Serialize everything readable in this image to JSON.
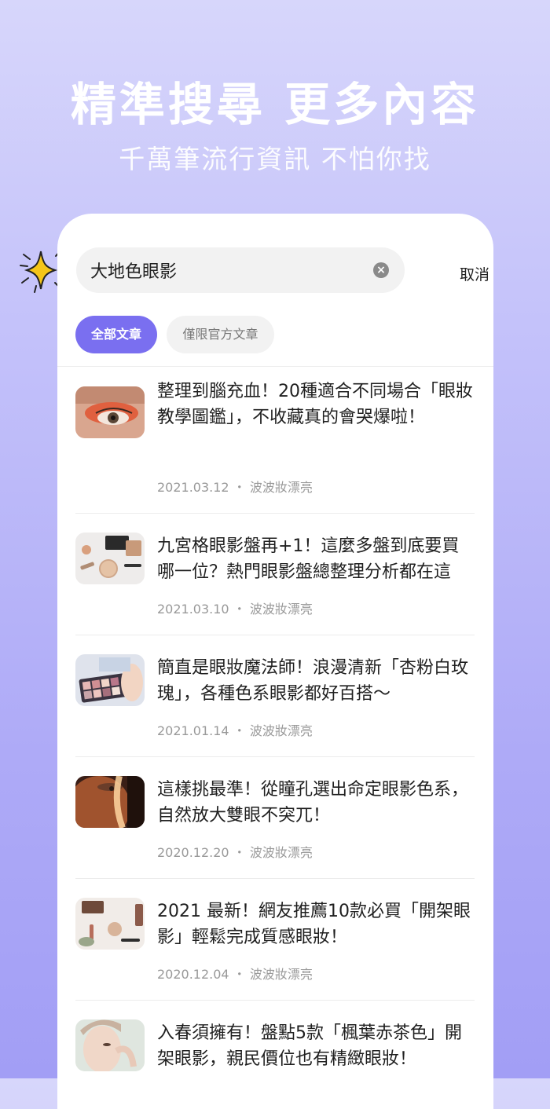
{
  "promo": {
    "headline": "精準搜尋 更多內容",
    "subheadline": "千萬筆流行資訊 不怕你找"
  },
  "search": {
    "query": "大地色眼影",
    "cancel_label": "取消"
  },
  "filters": {
    "all_label": "全部文章",
    "official_label": "僅限官方文章",
    "selected": "全部文章"
  },
  "articles": [
    {
      "title": "整理到腦充血！20種適合不同場合「眼妝教學圖鑑」，不收藏真的會哭爆啦！",
      "date": "2021.03.12",
      "author": "波波妝漂亮",
      "thumb": "eye-closeup-photo"
    },
    {
      "title": "九宮格眼影盤再+1！這麼多盤到底要買哪一位？熱門眼影盤總整理分析都在這",
      "date": "2021.03.10",
      "author": "波波妝漂亮",
      "thumb": "makeup-products-photo"
    },
    {
      "title": "簡直是眼妝魔法師！浪漫清新「杏粉白玫瑰」，各種色系眼影都好百搭～",
      "date": "2021.01.14",
      "author": "波波妝漂亮",
      "thumb": "eyeshadow-palette-photo"
    },
    {
      "title": "這樣挑最準！從瞳孔選出命定眼影色系，自然放大雙眼不突兀！",
      "date": "2020.12.20",
      "author": "波波妝漂亮",
      "thumb": "face-light-photo"
    },
    {
      "title": "2021 最新！網友推薦10款必買「開架眼影」輕鬆完成質感眼妝！",
      "date": "2020.12.04",
      "author": "波波妝漂亮",
      "thumb": "flatlay-makeup-photo"
    },
    {
      "title": "入春須擁有！盤點5款「楓葉赤茶色」開架眼影，親民價位也有精緻眼妝！",
      "date": "",
      "author": "",
      "thumb": "woman-portrait-photo"
    }
  ],
  "separator": "・"
}
